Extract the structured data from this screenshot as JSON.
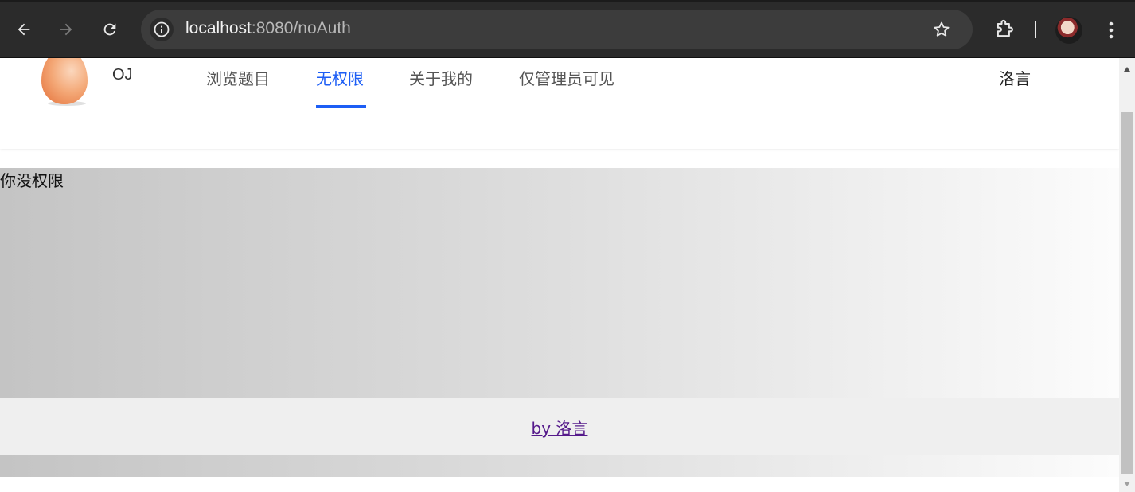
{
  "browser": {
    "url_host": "localhost",
    "url_path": ":8080/noAuth",
    "icons": {
      "back": "arrow-left-icon",
      "forward": "arrow-right-icon",
      "reload": "reload-icon",
      "site_info": "info-icon",
      "bookmark": "star-icon",
      "extensions": "puzzle-icon",
      "menu": "kebab-menu-icon"
    }
  },
  "header": {
    "brand": "OJ",
    "nav": [
      {
        "label": "浏览题目",
        "active": false
      },
      {
        "label": "无权限",
        "active": true
      },
      {
        "label": "关于我的",
        "active": false
      },
      {
        "label": "仅管理员可见",
        "active": false
      }
    ],
    "user": "洛言"
  },
  "main": {
    "message": "你没权限"
  },
  "footer": {
    "link": "by 洛言"
  },
  "colors": {
    "accent": "#1d5ef5",
    "visited_link": "#551a8b"
  }
}
